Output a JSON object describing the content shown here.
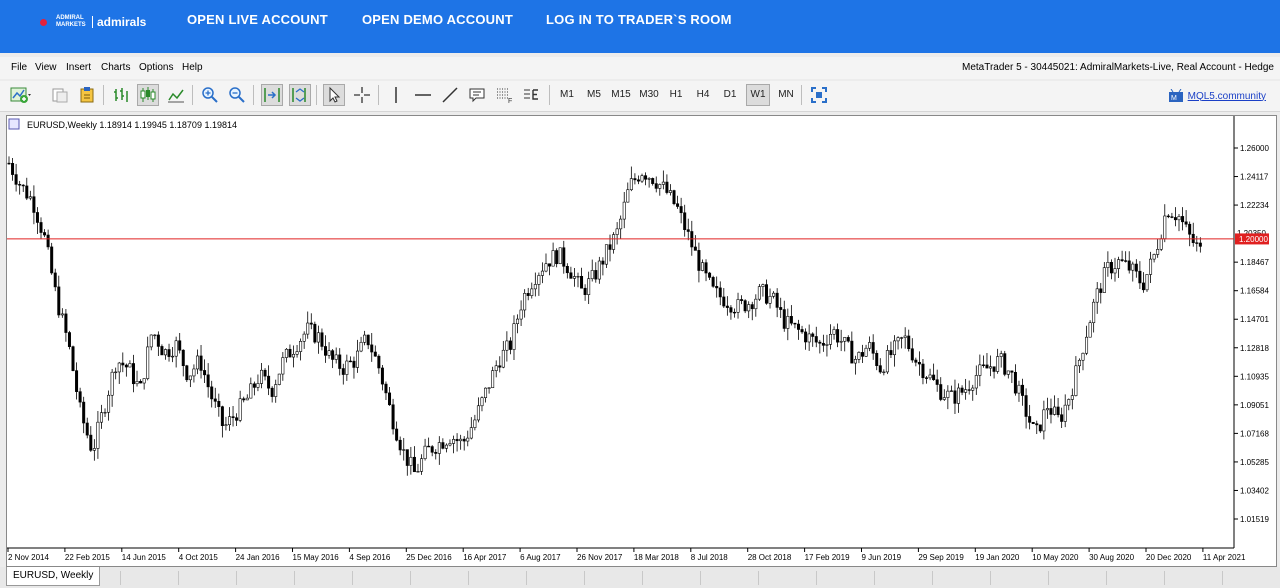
{
  "header": {
    "logo_small": "ADMIRAL MARKETS",
    "logo_name": "admirals",
    "nav": [
      "OPEN LIVE ACCOUNT",
      "OPEN DEMO ACCOUNT",
      "LOG IN TO TRADER`S ROOM"
    ]
  },
  "menu": {
    "items": [
      "File",
      "View",
      "Insert",
      "Charts",
      "Options",
      "Help"
    ],
    "account": "MetaTrader 5 - 30445021: AdmiralMarkets-Live, Real Account - Hedge"
  },
  "toolbar": {
    "timeframes": [
      "M1",
      "M5",
      "M15",
      "M30",
      "H1",
      "H4",
      "D1",
      "W1",
      "MN"
    ],
    "active_timeframe": "W1",
    "community_link": "MQL5.community"
  },
  "chart": {
    "info": "EURUSD,Weekly  1.18914 1.19945 1.18709 1.19814",
    "price_line_label": "1.20000",
    "price_line_value": 1.2,
    "hidden_tick_label": "1.20350",
    "tab_label": "EURUSD, Weekly"
  },
  "colors": {
    "header_bg": "#1e74e6",
    "price_line": "#e02020",
    "candle": "#000000"
  },
  "chart_data": {
    "type": "candlestick",
    "symbol": "EURUSD",
    "timeframe": "Weekly",
    "y_ticks": [
      1.26,
      1.24117,
      1.22234,
      1.18467,
      1.16584,
      1.14701,
      1.12818,
      1.10935,
      1.09051,
      1.07168,
      1.05285,
      1.03402,
      1.01519
    ],
    "ylim": [
      1.0,
      1.277
    ],
    "x_ticks": [
      "2 Nov 2014",
      "22 Feb 2015",
      "14 Jun 2015",
      "4 Oct 2015",
      "24 Jan 2016",
      "15 May 2016",
      "4 Sep 2016",
      "25 Dec 2016",
      "16 Apr 2017",
      "6 Aug 2017",
      "26 Nov 2017",
      "18 Mar 2018",
      "8 Jul 2018",
      "28 Oct 2018",
      "17 Feb 2019",
      "9 Jun 2019",
      "29 Sep 2019",
      "19 Jan 2020",
      "10 May 2020",
      "30 Aug 2020",
      "20 Dec 2020",
      "11 Apr 2021"
    ],
    "weeks_per_tick": 16,
    "trend_closes": [
      1.25,
      1.235,
      1.225,
      1.2,
      1.16,
      1.13,
      1.085,
      1.06,
      1.09,
      1.12,
      1.115,
      1.1,
      1.14,
      1.125,
      1.13,
      1.11,
      1.12,
      1.095,
      1.075,
      1.085,
      1.095,
      1.11,
      1.1,
      1.12,
      1.13,
      1.14,
      1.135,
      1.12,
      1.115,
      1.12,
      1.135,
      1.115,
      1.085,
      1.06,
      1.045,
      1.06,
      1.065,
      1.07,
      1.065,
      1.08,
      1.1,
      1.12,
      1.13,
      1.16,
      1.175,
      1.185,
      1.19,
      1.18,
      1.165,
      1.175,
      1.19,
      1.205,
      1.235,
      1.245,
      1.24,
      1.232,
      1.22,
      1.2,
      1.18,
      1.165,
      1.16,
      1.155,
      1.158,
      1.165,
      1.16,
      1.145,
      1.14,
      1.135,
      1.13,
      1.14,
      1.13,
      1.12,
      1.13,
      1.115,
      1.125,
      1.135,
      1.12,
      1.11,
      1.1,
      1.095,
      1.1,
      1.11,
      1.115,
      1.12,
      1.11,
      1.09,
      1.07,
      1.09,
      1.08,
      1.1,
      1.13,
      1.16,
      1.18,
      1.185,
      1.18,
      1.17,
      1.19,
      1.22,
      1.215,
      1.2,
      1.19,
      1.198
    ]
  }
}
